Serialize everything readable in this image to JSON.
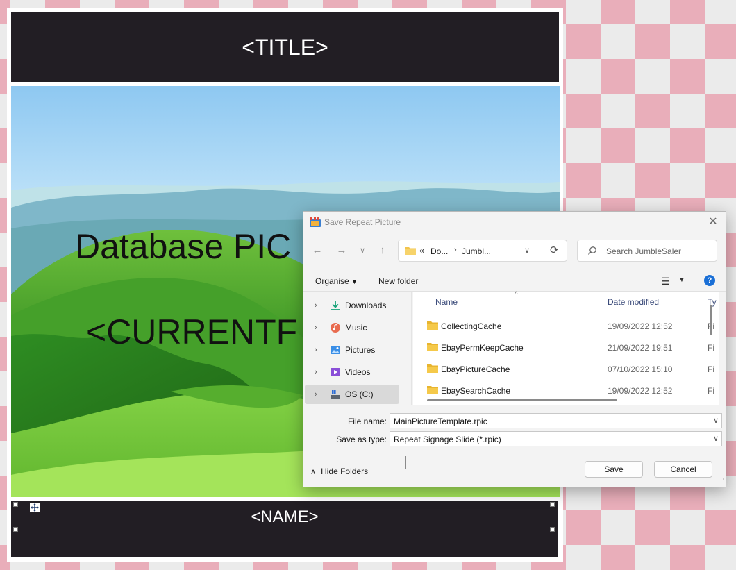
{
  "template": {
    "title": "<TITLE>",
    "database_text": "Database PIC",
    "current_text": "<CURRENTF",
    "name": "<NAME>"
  },
  "dialog": {
    "title": "Save Repeat Picture",
    "breadcrumb": [
      "Do...",
      "Jumbl..."
    ],
    "search_placeholder": "Search JumbleSaler",
    "organise_label": "Organise",
    "new_folder_label": "New folder",
    "help_label": "?",
    "nav_items": [
      {
        "label": "Downloads",
        "icon": "download-icon"
      },
      {
        "label": "Music",
        "icon": "music-icon"
      },
      {
        "label": "Pictures",
        "icon": "pictures-icon"
      },
      {
        "label": "Videos",
        "icon": "videos-icon"
      },
      {
        "label": "OS (C:)",
        "icon": "drive-icon",
        "selected": true
      }
    ],
    "columns": {
      "name": "Name",
      "date": "Date modified",
      "type": "Ty"
    },
    "files": [
      {
        "name": "CollectingCache",
        "date": "19/09/2022 12:52",
        "type": "Fi"
      },
      {
        "name": "EbayPermKeepCache",
        "date": "21/09/2022 19:51",
        "type": "Fi"
      },
      {
        "name": "EbayPictureCache",
        "date": "07/10/2022 15:10",
        "type": "Fi"
      },
      {
        "name": "EbaySearchCache",
        "date": "19/09/2022 12:52",
        "type": "Fi"
      }
    ],
    "file_name_label": "File name:",
    "file_name_value": "MainPictureTemplate.rpic",
    "save_type_label": "Save as type:",
    "save_type_value": "Repeat Signage Slide (*.rpic)",
    "hide_folders_label": "Hide Folders",
    "save_label": "Save",
    "cancel_label": "Cancel"
  },
  "colors": {
    "bar_bg": "#221e24",
    "folder": "#f2c44d",
    "accent": "#1a6fd6",
    "checker_pink": "#e9aeba",
    "checker_gray": "#ebebeb"
  }
}
